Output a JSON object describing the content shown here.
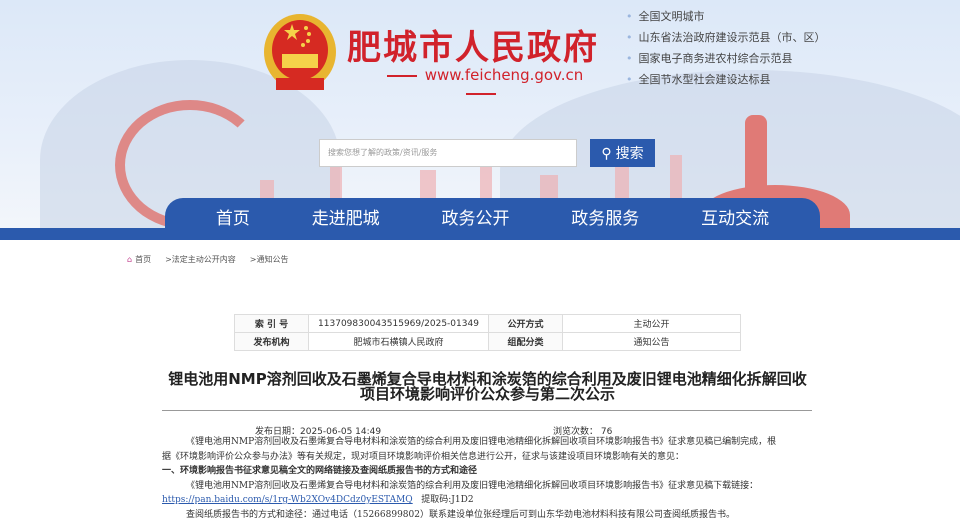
{
  "header": {
    "site_title": "肥城市人民政府",
    "url": "www.feicheng.gov.cn",
    "honors": [
      "全国文明城市",
      "山东省法治政府建设示范县（市、区）",
      "国家电子商务进农村综合示范县",
      "全国节水型社会建设达标县"
    ]
  },
  "search": {
    "placeholder": "搜索您想了解的政策/资讯/服务",
    "button": "搜索"
  },
  "nav": [
    "首页",
    "走进肥城",
    "政务公开",
    "政务服务",
    "互动交流"
  ],
  "breadcrumb": [
    "首页",
    ">法定主动公开内容",
    ">通知公告"
  ],
  "info_table": {
    "index_label": "索 引 号",
    "index_value": "11370983004351596​9/2025-01349",
    "open_label": "公开方式",
    "open_value": "主动公开",
    "org_label": "发布机构",
    "org_value": "肥城市石横镇人民政府",
    "cat_label": "组配分类",
    "cat_value": "通知公告"
  },
  "article": {
    "title_line1": "锂电池用NMP溶剂回收及石墨烯复合导电材料和涂炭箔的综合利用及废旧锂电池精细化拆解回收",
    "title_line2": "项目环境影响评价公众参与第二次公示",
    "date": "发布日期：2025-06-05 14:49",
    "views": "浏览次数： 76",
    "p1": "《锂电池用NMP溶剂回收及石墨烯复合导电材料和涂炭箔的综合利用及废旧锂电池精细化拆解回收项目环境影响报告书》征求意见稿已编制完成，根",
    "p1b": "据《环境影响评价公众参与办法》等有关规定，现对项目环境影响评价相关信息进行公开，征求与该建设项目环境影响有关的意见：",
    "h1": "一、环境影响报告书征求意见稿全文的网络链接及查阅纸质报告书的方式和途径",
    "p2": "《锂电池用NMP溶剂回收及石墨烯复合导电材料和涂炭箔的综合利用及废旧锂电池精细化拆解回收项目环境影响报告书》征求意见稿下载链接：",
    "link": "https://pan.baidu.com/s/1rg-Wb2XOv4DCdz0yESTAMQ",
    "code": "提取码:J1D2",
    "p3": "查阅纸质报告书的方式和途径：通过电话（15266899802）联系建设单位张经理后可到山东华劲电池材料科技有限公司查阅纸质报告书。"
  }
}
